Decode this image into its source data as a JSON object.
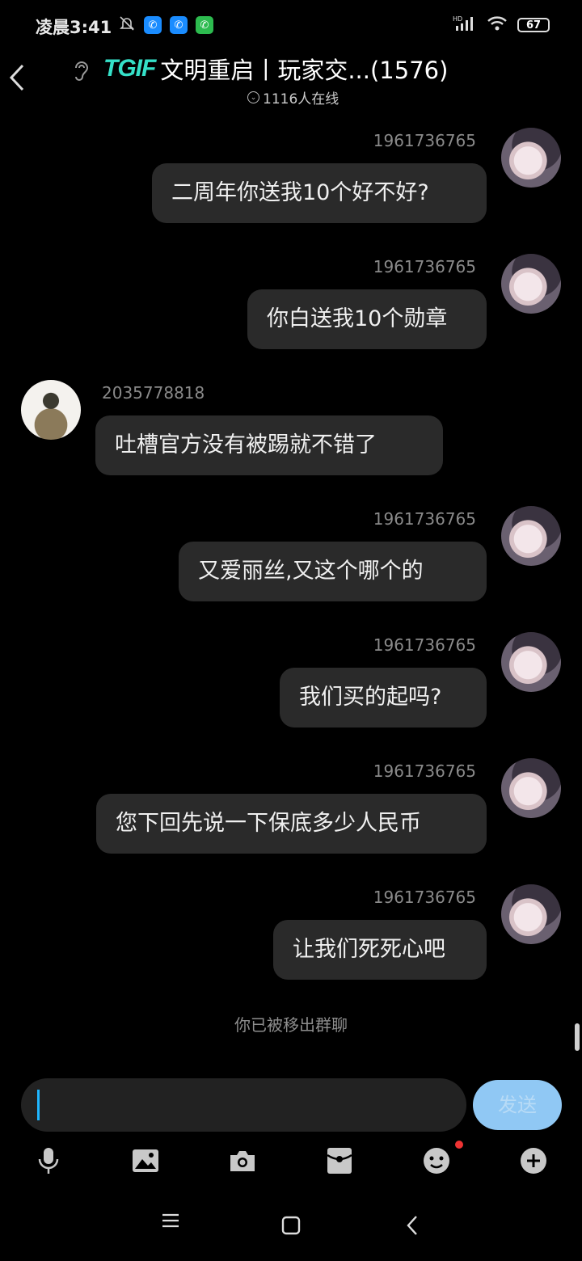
{
  "status_bar": {
    "time": "凌晨3:41",
    "battery": "67",
    "network": "HD"
  },
  "header": {
    "logo_text": "TGIF",
    "title": "文明重启丨玩家交...(1576)",
    "online": "1116人在线"
  },
  "messages": [
    {
      "side": "right",
      "sender": "1961736765",
      "text": "二周年你送我10个好不好?"
    },
    {
      "side": "right",
      "sender": "1961736765",
      "text": "你白送我10个勋章"
    },
    {
      "side": "left",
      "sender": "2035778818",
      "text": "吐槽官方没有被踢就不错了"
    },
    {
      "side": "right",
      "sender": "1961736765",
      "text": "又爱丽丝,又这个哪个的"
    },
    {
      "side": "right",
      "sender": "1961736765",
      "text": "我们买的起吗?"
    },
    {
      "side": "right",
      "sender": "1961736765",
      "text": "您下回先说一下保底多少人民币"
    },
    {
      "side": "right",
      "sender": "1961736765",
      "text": "让我们死死心吧"
    }
  ],
  "system_note": "你已被移出群聊",
  "input": {
    "value": "",
    "send_label": "发送"
  },
  "toolbar": [
    "mic-icon",
    "image-icon",
    "camera-icon",
    "red-packet-icon",
    "emoji-icon",
    "plus-icon"
  ],
  "nav": [
    "menu-icon",
    "home-icon",
    "back-icon"
  ]
}
